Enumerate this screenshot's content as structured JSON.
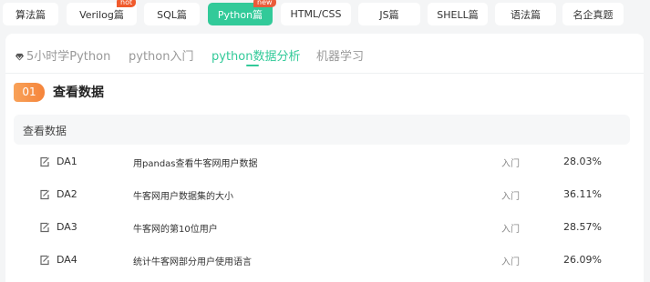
{
  "top_tabs": [
    {
      "label": "算法篇",
      "active": false
    },
    {
      "label": "Verilog篇",
      "active": false,
      "badge": "hot"
    },
    {
      "label": "SQL篇",
      "active": false
    },
    {
      "label": "Python篇",
      "active": true,
      "badge": "new"
    },
    {
      "label": "HTML/CSS",
      "active": false
    },
    {
      "label": "JS篇",
      "active": false
    },
    {
      "label": "SHELL篇",
      "active": false
    },
    {
      "label": "语法篇",
      "active": false
    },
    {
      "label": "名企真题",
      "active": false
    }
  ],
  "sub_tabs": [
    {
      "label": "5小时学Python",
      "active": false,
      "icon": "diamond-icon"
    },
    {
      "label": "python入门",
      "active": false
    },
    {
      "label": "python数据分析",
      "active": true
    },
    {
      "label": "机器学习",
      "active": false
    }
  ],
  "section": {
    "number": "01",
    "title": "查看数据"
  },
  "group": {
    "title": "查看数据"
  },
  "questions": [
    {
      "id": "DA1",
      "title": "用pandas查看牛客网用户数据",
      "level": "入门",
      "pass_rate": "28.03%"
    },
    {
      "id": "DA2",
      "title": "牛客网用户数据集的大小",
      "level": "入门",
      "pass_rate": "36.11%"
    },
    {
      "id": "DA3",
      "title": "牛客网的第10位用户",
      "level": "入门",
      "pass_rate": "28.57%"
    },
    {
      "id": "DA4",
      "title": "统计牛客网部分用户使用语言",
      "level": "入门",
      "pass_rate": "26.09%"
    }
  ],
  "colors": {
    "accent": "#32ca99",
    "badge_orange": "#f5843a",
    "hot": "#f05a2c"
  }
}
